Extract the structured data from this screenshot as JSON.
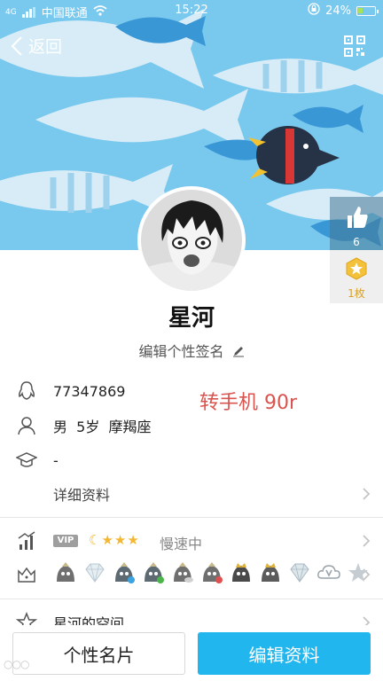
{
  "status_bar": {
    "network_type": "4G",
    "carrier": "中国联通",
    "time": "15:22",
    "battery_percent": "24%",
    "battery_level": 0.24
  },
  "header": {
    "back_label": "返回",
    "icons": [
      "chevron-left-icon",
      "qr-code-icon"
    ]
  },
  "side_panel": {
    "likes": "6",
    "badge_count": "1枚"
  },
  "profile": {
    "nickname": "星河",
    "signature_prompt": "编辑个性签名"
  },
  "info": {
    "qq_number": "77347869",
    "details": "男  5岁  摩羯座",
    "school": "-",
    "more_label": "详细资料",
    "stamp_text": "转手机 90r"
  },
  "level_row": {
    "vip_label": "VIP",
    "level_icons": [
      "☾",
      "★",
      "★",
      "★"
    ],
    "speed_text": "慢速中"
  },
  "badge_row": {
    "icons": [
      "penguin-badge-icon",
      "diamond-badge-icon",
      "penguin-badge-icon",
      "penguin-badge-icon",
      "penguin-badge-icon",
      "penguin-badge-icon",
      "penguin-badge-icon",
      "penguin-badge-icon",
      "diamond-badge-icon",
      "cloud-v-badge-icon",
      "star-badge-icon"
    ]
  },
  "space_row": {
    "label": "星河的空间"
  },
  "bottom_bar": {
    "card_button": "个性名片",
    "edit_button": "编辑资料"
  },
  "colors": {
    "accent": "#21b6ee",
    "stamp": "#d9534f",
    "cover": "#79c8ee"
  }
}
